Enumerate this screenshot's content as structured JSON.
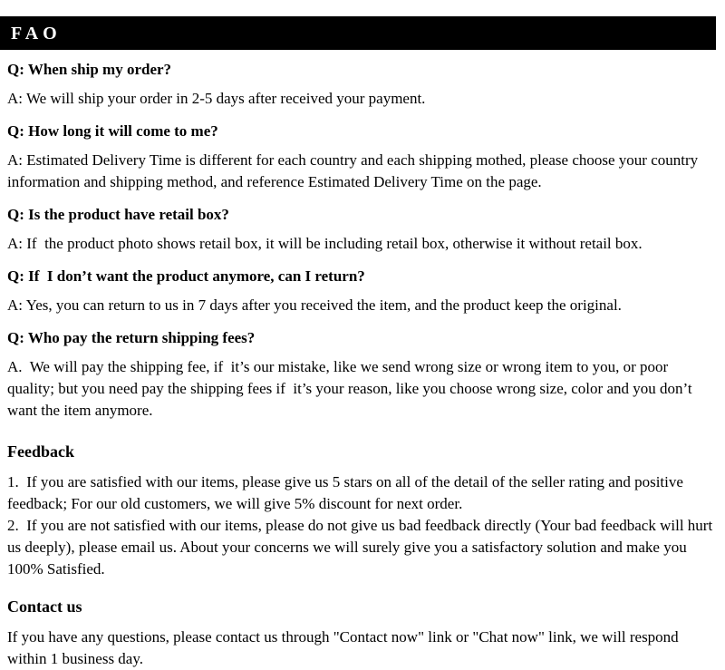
{
  "banner": {
    "title": "FAO"
  },
  "faq": {
    "items": [
      {
        "question": "Q: When ship my order?",
        "answer": "A: We will ship your order in 2-5 days after received your payment."
      },
      {
        "question": "Q: How long it will come to me?",
        "answer": "A: Estimated Delivery Time is different for each country and each shipping mothed, please choose your country information and shipping method, and reference Estimated Delivery Time on the page."
      },
      {
        "question": "Q: Is the product have retail box?",
        "answer": "A: If  the product photo shows retail box, it will be including retail box, otherwise it without retail box."
      },
      {
        "question": "Q: If  I don’t want the product anymore, can I return?",
        "answer": "A: Yes, you can return to us in 7 days after you received the item, and the product keep the original."
      },
      {
        "question": "Q: Who pay the return shipping fees?",
        "answer": "A.  We will pay the shipping fee, if  it’s our mistake, like we send wrong size or wrong item to you, or poor quality; but you need pay the shipping fees if  it’s your reason, like you choose wrong size, color and you don’t want the item anymore."
      }
    ]
  },
  "feedback": {
    "heading": "Feedback",
    "items": [
      "1.  If you are satisfied with our items, please give us 5 stars on all of the detail of the seller rating and positive feedback; For our old customers, we will give 5% discount for next order.",
      "2.  If you are not satisfied with our items, please do not give us bad feedback directly (Your bad feedback will hurt us deeply), please email us. About your concerns we will surely give you a satisfactory solution and make you 100% Satisfied."
    ]
  },
  "contact": {
    "heading": "Contact us",
    "text": "If you have any questions, please contact us through \"Contact now\" link or \"Chat now\" link, we will respond within 1 business day."
  },
  "colors": {
    "banner_background": "#000000",
    "banner_text": "#ffffff",
    "page_background": "#ffffff",
    "body_text": "#000000"
  }
}
